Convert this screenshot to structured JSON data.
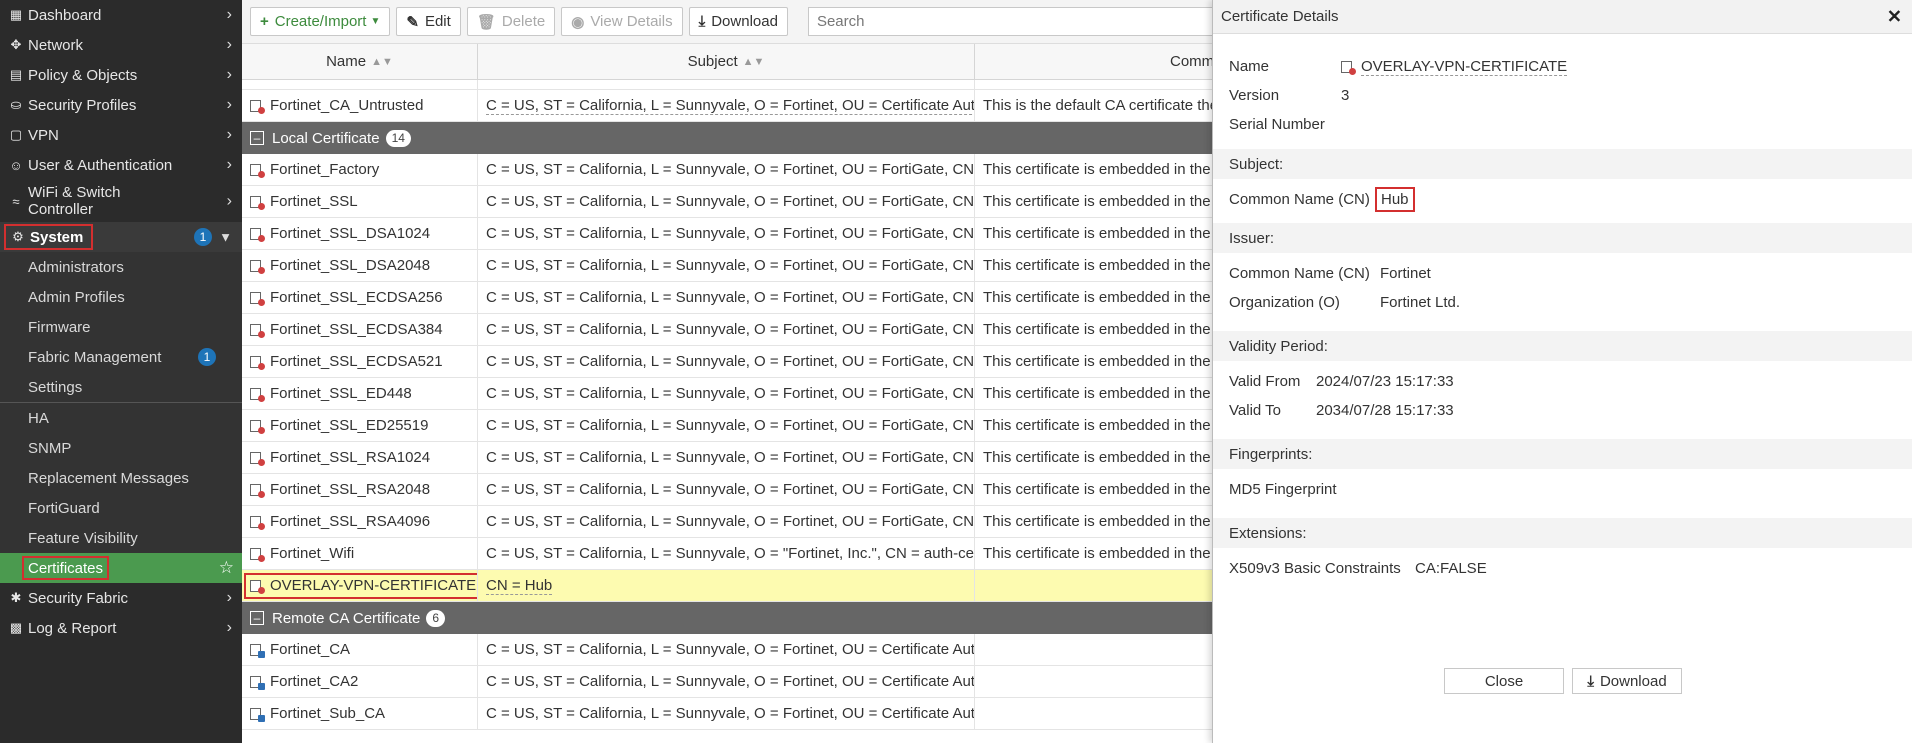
{
  "sidebar": {
    "items": [
      {
        "icon": "dashboard-icon",
        "label": "Dashboard"
      },
      {
        "icon": "network-icon",
        "label": "Network"
      },
      {
        "icon": "policy-icon",
        "label": "Policy & Objects"
      },
      {
        "icon": "security-profiles-icon",
        "label": "Security Profiles"
      },
      {
        "icon": "vpn-icon",
        "label": "VPN"
      },
      {
        "icon": "user-icon",
        "label": "User & Authentication"
      },
      {
        "icon": "wifi-icon",
        "label": "WiFi & Switch Controller"
      }
    ],
    "system": {
      "label": "System",
      "badge": "1"
    },
    "system_children_1": [
      {
        "label": "Administrators"
      },
      {
        "label": "Admin Profiles"
      },
      {
        "label": "Firmware"
      },
      {
        "label": "Fabric Management",
        "badge": "1"
      },
      {
        "label": "Settings"
      }
    ],
    "system_children_2": [
      {
        "label": "HA"
      },
      {
        "label": "SNMP"
      },
      {
        "label": "Replacement Messages"
      },
      {
        "label": "FortiGuard"
      },
      {
        "label": "Feature Visibility"
      }
    ],
    "certificates": {
      "label": "Certificates"
    },
    "bottom_items": [
      {
        "label": "Security Fabric"
      },
      {
        "label": "Log & Report"
      }
    ]
  },
  "toolbar": {
    "create_label": "Create/Import",
    "edit_label": "Edit",
    "delete_label": "Delete",
    "view_label": "View Details",
    "download_label": "Download",
    "search_placeholder": "Search"
  },
  "table": {
    "headers": {
      "name": "Name",
      "subject": "Subject",
      "comments": "Comme"
    },
    "top_row": {
      "name": "Fortinet_CA_Untrusted",
      "subject": "C = US, ST = California, L = Sunnyvale, O = Fortinet, OU = Certificate Aut...",
      "comments": "This is the default CA certificate the"
    },
    "local_group": {
      "label": "Local Certificate",
      "count": "14"
    },
    "local_rows": [
      {
        "name": "Fortinet_Factory",
        "subject": "C = US, ST = California, L = Sunnyvale, O = Fortinet, OU = FortiGate, CN ...",
        "comments": "This certificate is embedded in the h"
      },
      {
        "name": "Fortinet_SSL",
        "subject": "C = US, ST = California, L = Sunnyvale, O = Fortinet, OU = FortiGate, CN ...",
        "comments": "This certificate is embedded in the h"
      },
      {
        "name": "Fortinet_SSL_DSA1024",
        "subject": "C = US, ST = California, L = Sunnyvale, O = Fortinet, OU = FortiGate, CN ...",
        "comments": "This certificate is embedded in the h"
      },
      {
        "name": "Fortinet_SSL_DSA2048",
        "subject": "C = US, ST = California, L = Sunnyvale, O = Fortinet, OU = FortiGate, CN ...",
        "comments": "This certificate is embedded in the h"
      },
      {
        "name": "Fortinet_SSL_ECDSA256",
        "subject": "C = US, ST = California, L = Sunnyvale, O = Fortinet, OU = FortiGate, CN ...",
        "comments": "This certificate is embedded in the h"
      },
      {
        "name": "Fortinet_SSL_ECDSA384",
        "subject": "C = US, ST = California, L = Sunnyvale, O = Fortinet, OU = FortiGate, CN ...",
        "comments": "This certificate is embedded in the h"
      },
      {
        "name": "Fortinet_SSL_ECDSA521",
        "subject": "C = US, ST = California, L = Sunnyvale, O = Fortinet, OU = FortiGate, CN ...",
        "comments": "This certificate is embedded in the h"
      },
      {
        "name": "Fortinet_SSL_ED448",
        "subject": "C = US, ST = California, L = Sunnyvale, O = Fortinet, OU = FortiGate, CN ...",
        "comments": "This certificate is embedded in the h"
      },
      {
        "name": "Fortinet_SSL_ED25519",
        "subject": "C = US, ST = California, L = Sunnyvale, O = Fortinet, OU = FortiGate, CN ...",
        "comments": "This certificate is embedded in the h"
      },
      {
        "name": "Fortinet_SSL_RSA1024",
        "subject": "C = US, ST = California, L = Sunnyvale, O = Fortinet, OU = FortiGate, CN ...",
        "comments": "This certificate is embedded in the h"
      },
      {
        "name": "Fortinet_SSL_RSA2048",
        "subject": "C = US, ST = California, L = Sunnyvale, O = Fortinet, OU = FortiGate, CN ...",
        "comments": "This certificate is embedded in the h"
      },
      {
        "name": "Fortinet_SSL_RSA4096",
        "subject": "C = US, ST = California, L = Sunnyvale, O = Fortinet, OU = FortiGate, CN ...",
        "comments": "This certificate is embedded in the h"
      },
      {
        "name": "Fortinet_Wifi",
        "subject": "C = US, ST = California, L = Sunnyvale, O = \"Fortinet, Inc.\", CN = auth-cert...",
        "comments": "This certificate is embedded in the f"
      }
    ],
    "overlay_row": {
      "name": "OVERLAY-VPN-CERTIFICATE",
      "subject": "CN = Hub",
      "comments": ""
    },
    "remote_group": {
      "label": "Remote CA Certificate",
      "count": "6"
    },
    "remote_rows": [
      {
        "name": "Fortinet_CA",
        "subject": "C = US, ST = California, L = Sunnyvale, O = Fortinet, OU = Certificate Aut...",
        "comments": ""
      },
      {
        "name": "Fortinet_CA2",
        "subject": "C = US, ST = California, L = Sunnyvale, O = Fortinet, OU = Certificate Aut...",
        "comments": ""
      },
      {
        "name": "Fortinet_Sub_CA",
        "subject": "C = US, ST = California, L = Sunnyvale, O = Fortinet, OU = Certificate Aut...",
        "comments": ""
      }
    ]
  },
  "details": {
    "title": "Certificate Details",
    "name_label": "Name",
    "name_value": "OVERLAY-VPN-CERTIFICATE",
    "version_label": "Version",
    "version_value": "3",
    "serial_label": "Serial Number",
    "subject_section": "Subject:",
    "subject_cn_label": "Common Name (CN)",
    "subject_cn_value": "Hub",
    "issuer_section": "Issuer:",
    "issuer_cn_label": "Common Name (CN)",
    "issuer_cn_value": "Fortinet",
    "issuer_o_label": "Organization (O)",
    "issuer_o_value": "Fortinet Ltd.",
    "validity_section": "Validity Period:",
    "valid_from_label": "Valid From",
    "valid_from_value": "2024/07/23 15:17:33",
    "valid_to_label": "Valid To",
    "valid_to_value": "2034/07/28 15:17:33",
    "fingerprints_section": "Fingerprints:",
    "md5_label": "MD5 Fingerprint",
    "extensions_section": "Extensions:",
    "ext_label": "X509v3 Basic Constraints",
    "ext_value": "CA:FALSE",
    "close_label": "Close",
    "download_label": "Download"
  }
}
